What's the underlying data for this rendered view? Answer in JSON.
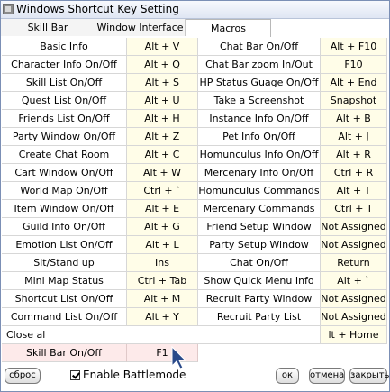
{
  "window": {
    "title": "Windows Shortcut Key Setting"
  },
  "tabs": [
    {
      "label": "Skill Bar"
    },
    {
      "label": "Window Interface"
    },
    {
      "label": "Macros"
    }
  ],
  "rows": [
    [
      "Basic Info",
      "Alt + V",
      "Chat Bar On/Off",
      "Alt + F10"
    ],
    [
      "Character Info On/Off",
      "Alt + Q",
      "Chat Bar zoom In/Out",
      "F10"
    ],
    [
      "Skill List On/Off",
      "Alt + S",
      "HP Status Guage On/Off",
      "Alt + End"
    ],
    [
      "Quest List On/Off",
      "Alt + U",
      "Take a Screenshot",
      "Snapshot"
    ],
    [
      "Friends List On/Off",
      "Alt + H",
      "Instance Info On/Off",
      "Alt + B"
    ],
    [
      "Party Window On/Off",
      "Alt + Z",
      "Pet Info On/Off",
      "Alt + J"
    ],
    [
      "Create Chat Room",
      "Alt + C",
      "Homunculus Info On/Off",
      "Alt + R"
    ],
    [
      "Cart Window On/Off",
      "Alt + W",
      "Mercenary Info On/Off",
      "Ctrl + R"
    ],
    [
      "World Map On/Off",
      "Ctrl + `",
      "Homunculus Commands",
      "Alt + T"
    ],
    [
      "Item Window On/Off",
      "Alt + E",
      "Mercenary Commands",
      "Ctrl + T"
    ],
    [
      "Guild Info On/Off",
      "Alt + G",
      "Friend Setup Window",
      "Not Assigned"
    ],
    [
      "Emotion List On/Off",
      "Alt + L",
      "Party Setup Window",
      "Not Assigned"
    ],
    [
      "Sit/Stand up",
      "Ins",
      "Chat On/Off",
      "Return"
    ],
    [
      "Mini Map Status",
      "Ctrl + Tab",
      "Show Quick Menu Info",
      "Alt + `"
    ],
    [
      "Shortcut List On/Off",
      "Alt + M",
      "Recruit Party Window",
      "Not Assigned"
    ],
    [
      "Command List On/Off",
      "Alt + Y",
      "Recruit Party List",
      "Not Assigned"
    ]
  ],
  "close_row": {
    "label": "Close al",
    "key": "lt + Home"
  },
  "skill_row": {
    "label": "Skill Bar On/Off",
    "key": "F1"
  },
  "bottom": {
    "reset_label": "сброс",
    "enable_battlemode_label": "Enable Battlemode",
    "enable_battlemode_checked": true,
    "ok_label": "ок",
    "cancel_label": "отмена",
    "close_label": "закрыть"
  },
  "colors": {
    "key_cell": "#fffde8",
    "selected_row": "#fdeaea",
    "cursor": "#2a4a8a"
  }
}
